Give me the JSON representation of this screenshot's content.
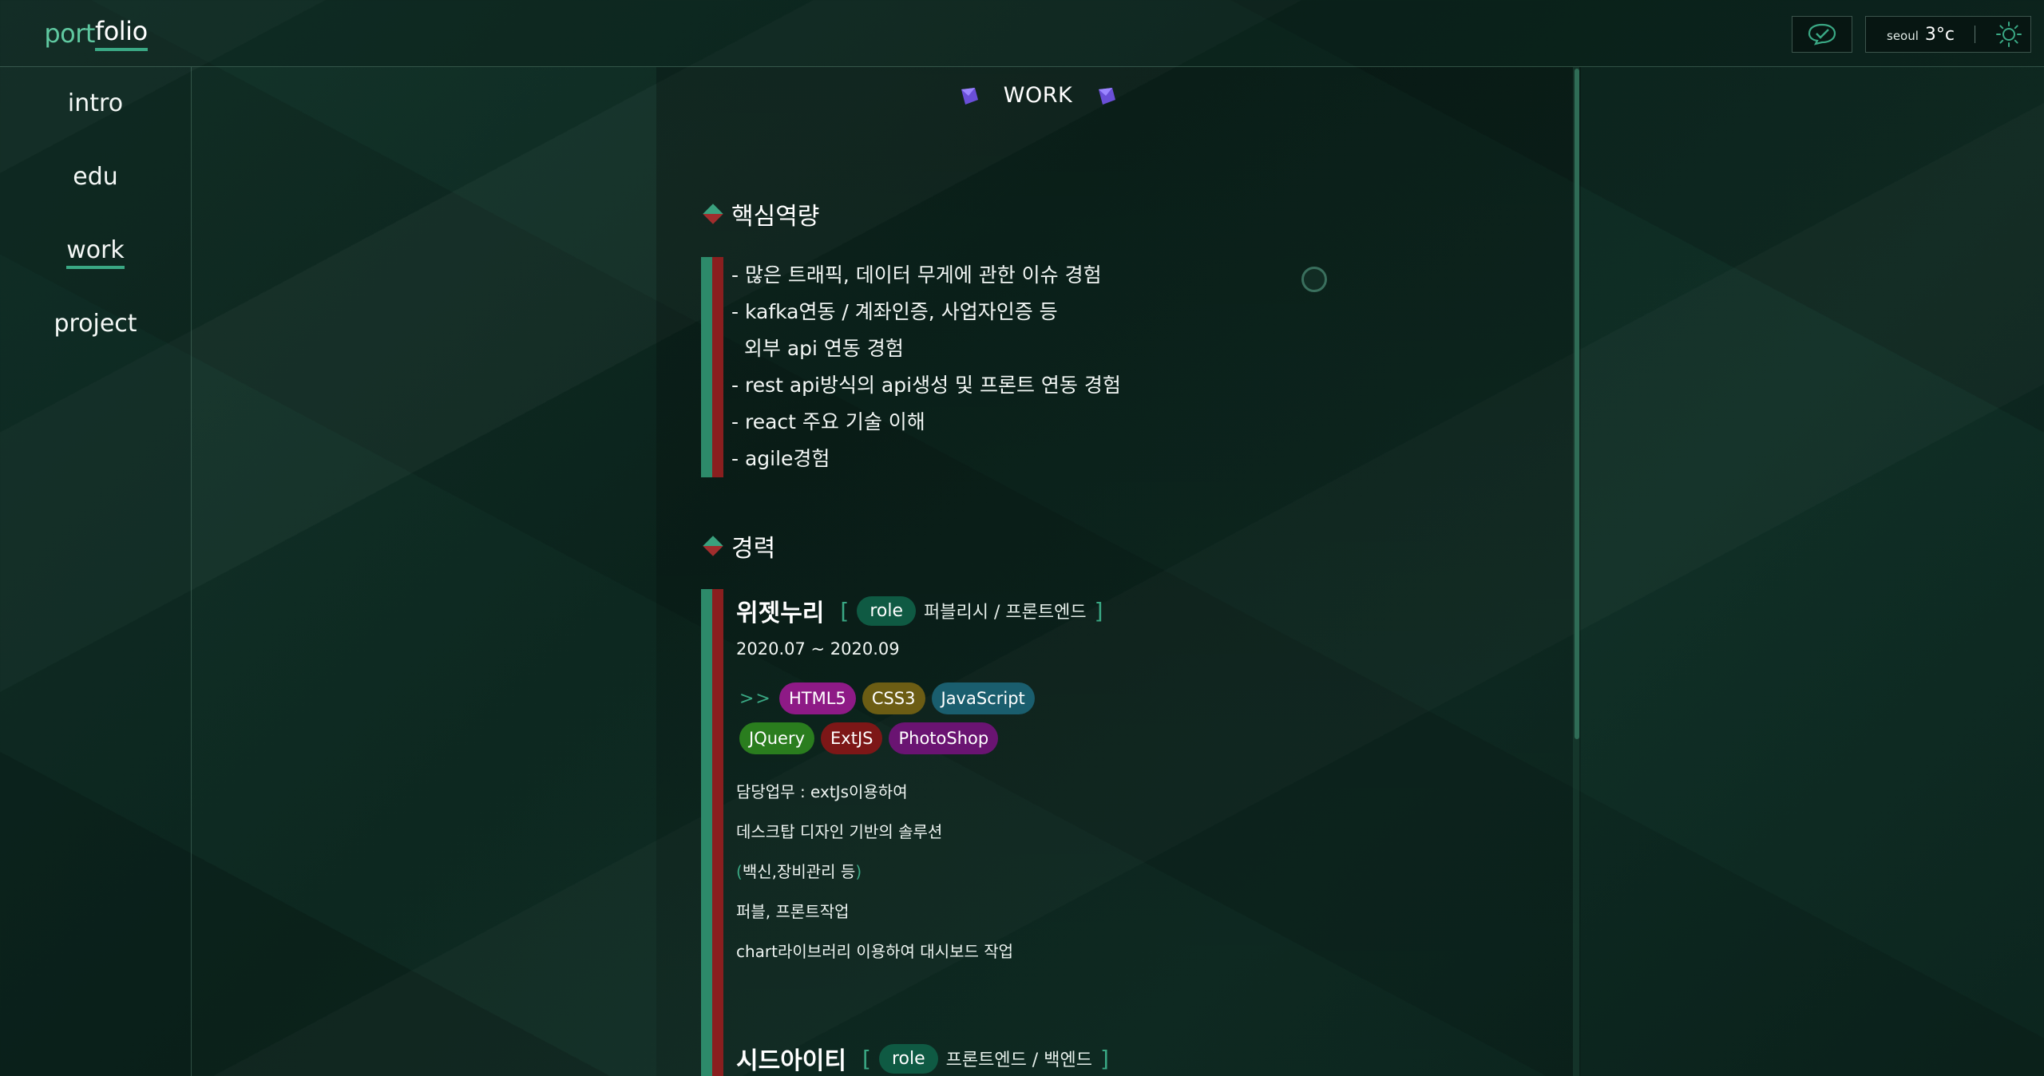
{
  "logo": {
    "part1": "port",
    "part2": "folio"
  },
  "nav": [
    {
      "label": "intro"
    },
    {
      "label": "edu"
    },
    {
      "label": "work"
    },
    {
      "label": "project"
    }
  ],
  "weather": {
    "city": "seoul",
    "temp": "3°c"
  },
  "section": {
    "title": "WORK"
  },
  "competency": {
    "heading": "핵심역량",
    "items": [
      "- 많은 트래픽, 데이터 무게에 관한 이슈 경험",
      "- kafka연동 / 계좌인증, 사업자인증 등",
      "  외부 api 연동 경험",
      "- rest api방식의 api생성 및 프론트 연동 경험",
      "- react 주요 기술 이해",
      "- agile경험"
    ]
  },
  "career": {
    "heading": "경력",
    "jobs": [
      {
        "company": "위젯누리",
        "role_label": "role",
        "role": "퍼블리시 / 프론트엔드",
        "period": "2020.07 ~ 2020.09",
        "arrow": ">>",
        "tags_row1": [
          {
            "name": "HTML5",
            "color": "#8e1a86"
          },
          {
            "name": "CSS3",
            "color": "#6c5d14"
          },
          {
            "name": "JavaScript",
            "color": "#1a5e6e"
          }
        ],
        "tags_row2": [
          {
            "name": "JQuery",
            "color": "#2a7d1e"
          },
          {
            "name": "ExtJS",
            "color": "#7d1717"
          },
          {
            "name": "PhotoShop",
            "color": "#6a1472"
          }
        ],
        "duty_label": "담당업무  :  extJs이용하여",
        "desc2": "데스크탑 디자인 기반의 솔루션",
        "desc3_open": "(",
        "desc3": "백신,장비관리 등",
        "desc3_close": ")",
        "desc4": "퍼블, 프론트작업",
        "desc5": "chart라이브러리 이용하여 대시보드 작업"
      },
      {
        "company": "시드아이티",
        "role_label": "role",
        "role": "프론트엔드 / 백엔드"
      }
    ]
  },
  "brand_colors": {
    "accent": "#3aa884",
    "accent_dark": "#0f5a43",
    "danger": "#8a1f1f"
  }
}
